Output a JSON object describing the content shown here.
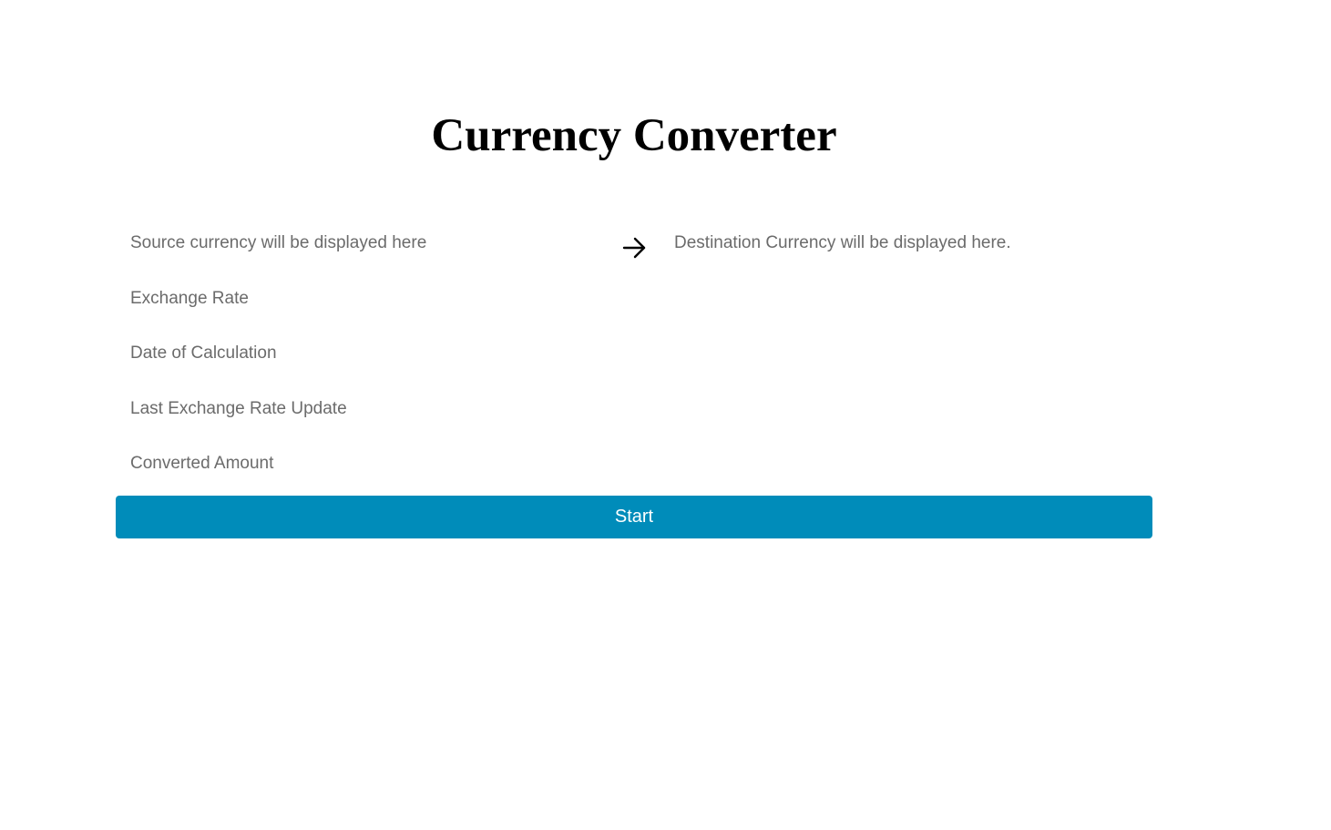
{
  "header": {
    "title": "Currency Converter"
  },
  "conversion": {
    "source_placeholder": "Source currency will be displayed here",
    "destination_placeholder": "Destination Currency will be displayed here.",
    "arrow_icon": "arrow-right-icon"
  },
  "details": {
    "exchange_rate": "Exchange Rate",
    "date_of_calculation": "Date of Calculation",
    "last_update": "Last Exchange Rate Update",
    "converted_amount": "Converted Amount"
  },
  "actions": {
    "start_label": "Start"
  },
  "colors": {
    "button_bg": "#008cba",
    "button_text": "#ffffff",
    "field_text": "#6b6b6b",
    "title_text": "#000000"
  }
}
